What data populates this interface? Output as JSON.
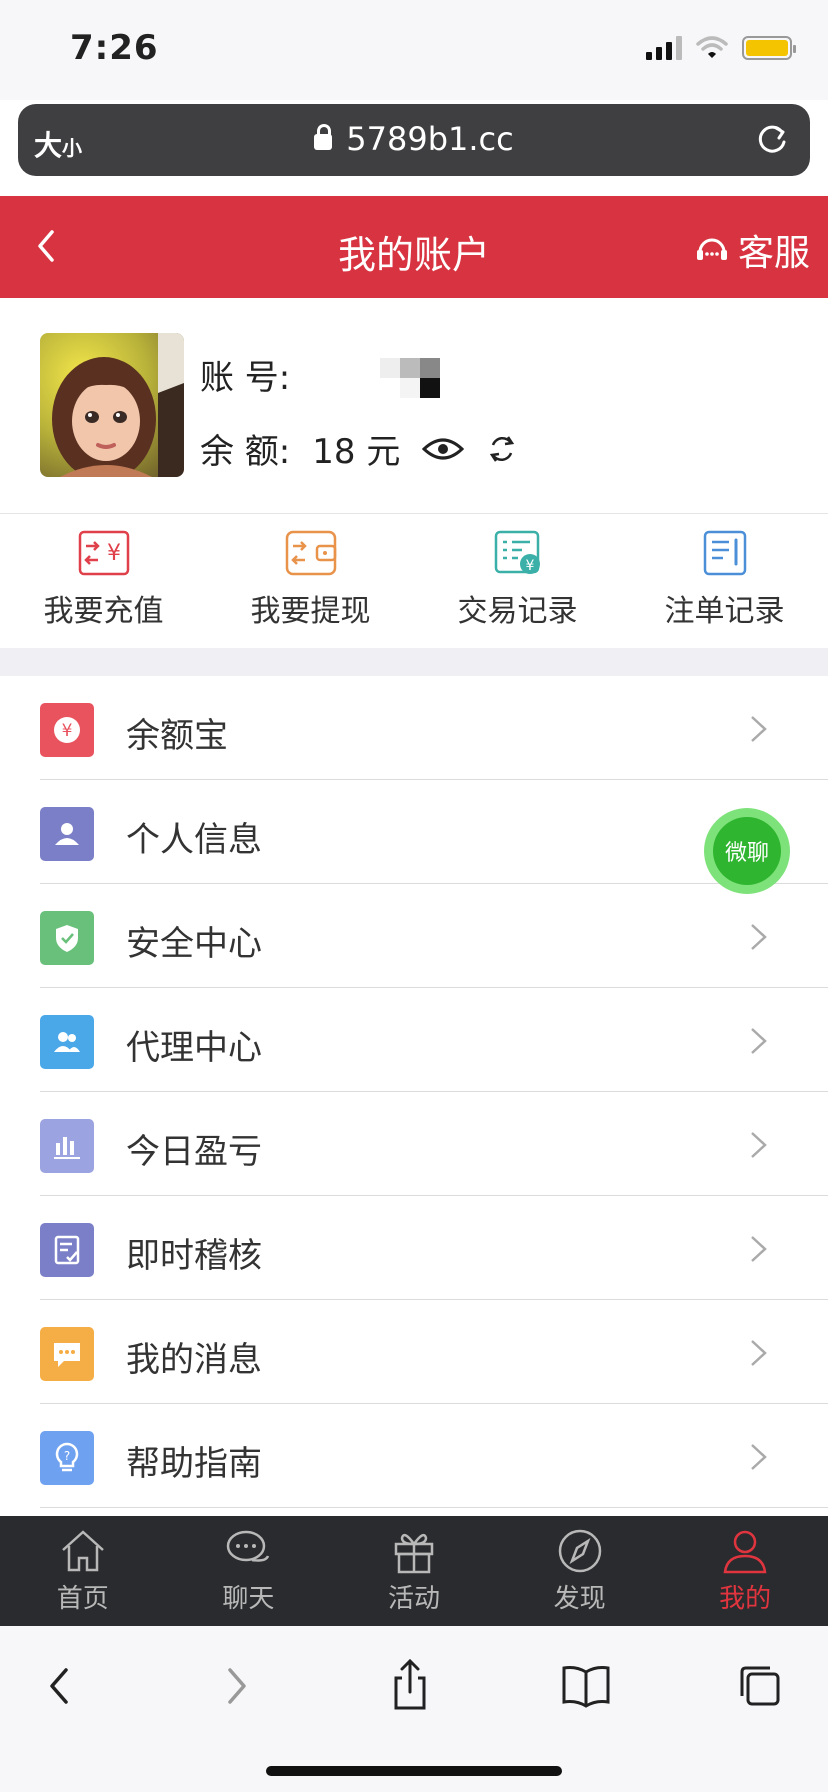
{
  "status_bar": {
    "time": "7:26"
  },
  "url_bar": {
    "text_size_big": "大",
    "text_size_small": "小",
    "host": "5789b1.cc"
  },
  "header": {
    "title": "我的账户",
    "service_label": "客服"
  },
  "account": {
    "account_label": "账 号:",
    "balance_label": "余 额:",
    "balance_value": "18 元"
  },
  "quick_actions": [
    {
      "label": "我要充值",
      "color": "#e0404a"
    },
    {
      "label": "我要提现",
      "color": "#e8924a"
    },
    {
      "label": "交易记录",
      "color": "#3ab0a8"
    },
    {
      "label": "注单记录",
      "color": "#4a8fd8"
    }
  ],
  "menu": [
    {
      "label": "余额宝",
      "icon": "yen-icon",
      "color": "#e9535e"
    },
    {
      "label": "个人信息",
      "icon": "user-icon",
      "color": "#7a7fc7"
    },
    {
      "label": "安全中心",
      "icon": "shield-icon",
      "color": "#68c07a"
    },
    {
      "label": "代理中心",
      "icon": "users-icon",
      "color": "#4aa8e8"
    },
    {
      "label": "今日盈亏",
      "icon": "bar-chart-icon",
      "color": "#9ba3e0"
    },
    {
      "label": "即时稽核",
      "icon": "checklist-icon",
      "color": "#7a7fc7"
    },
    {
      "label": "我的消息",
      "icon": "message-icon",
      "color": "#f5ad45"
    },
    {
      "label": "帮助指南",
      "icon": "lightbulb-icon",
      "color": "#6ea1f0"
    }
  ],
  "floating_chat": {
    "label": "微聊"
  },
  "tabbar": [
    {
      "label": "首页",
      "icon": "home-icon",
      "active": false
    },
    {
      "label": "聊天",
      "icon": "chat-icon",
      "active": false
    },
    {
      "label": "活动",
      "icon": "gift-icon",
      "active": false
    },
    {
      "label": "发现",
      "icon": "compass-icon",
      "active": false
    },
    {
      "label": "我的",
      "icon": "person-icon",
      "active": true
    }
  ],
  "colors": {
    "header_red": "#d83340",
    "tab_active": "#e0353f",
    "tabbar_bg": "#2a2b2e"
  }
}
